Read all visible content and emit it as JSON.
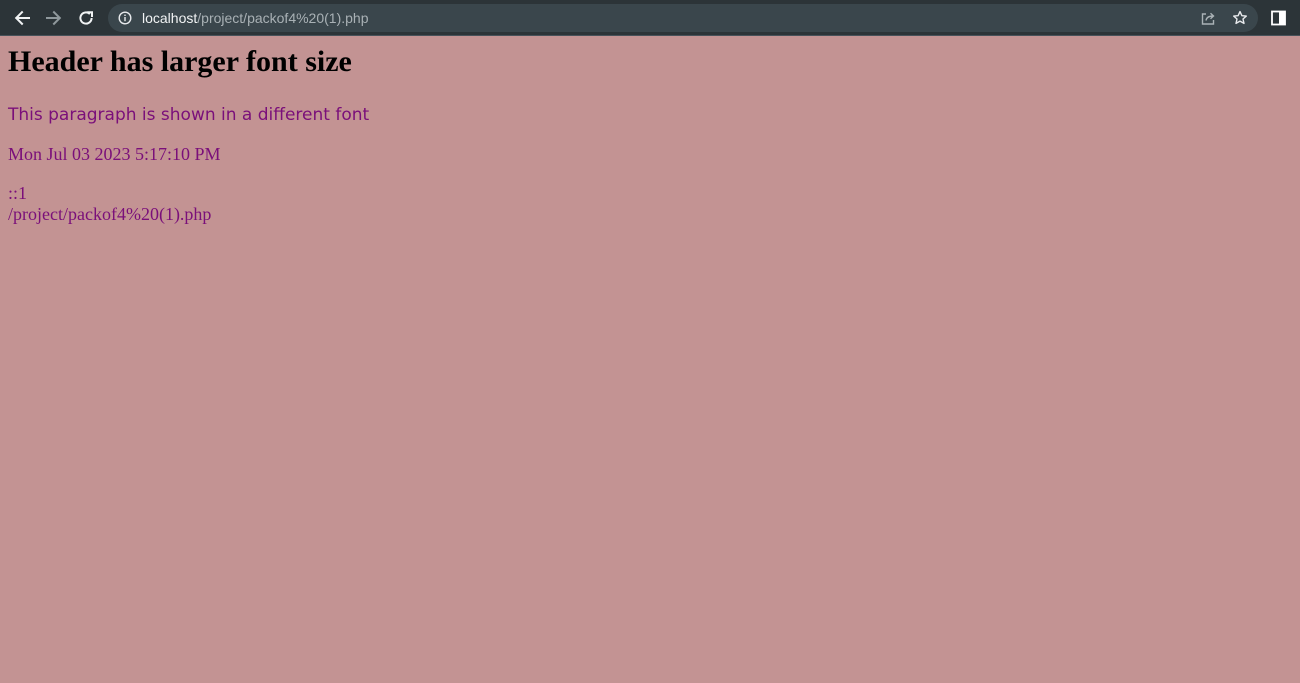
{
  "browser": {
    "url_host": "localhost",
    "url_path": "/project/packof4%20(1).php",
    "icons": [
      "back-arrow-icon",
      "forward-arrow-icon",
      "reload-icon",
      "info-icon",
      "share-icon",
      "star-icon",
      "side-panel-icon"
    ]
  },
  "page": {
    "heading": "Header has larger font size",
    "paragraph": "This paragraph is shown in a different font",
    "datetime": "Mon Jul 03 2023 5:17:10 PM",
    "remote_addr": "::1",
    "request_uri": "/project/packof4%20(1).php"
  },
  "colors": {
    "background": "#c39393",
    "text_accent": "#7a0f7a",
    "heading": "#000000",
    "toolbar": "#2c3438"
  }
}
